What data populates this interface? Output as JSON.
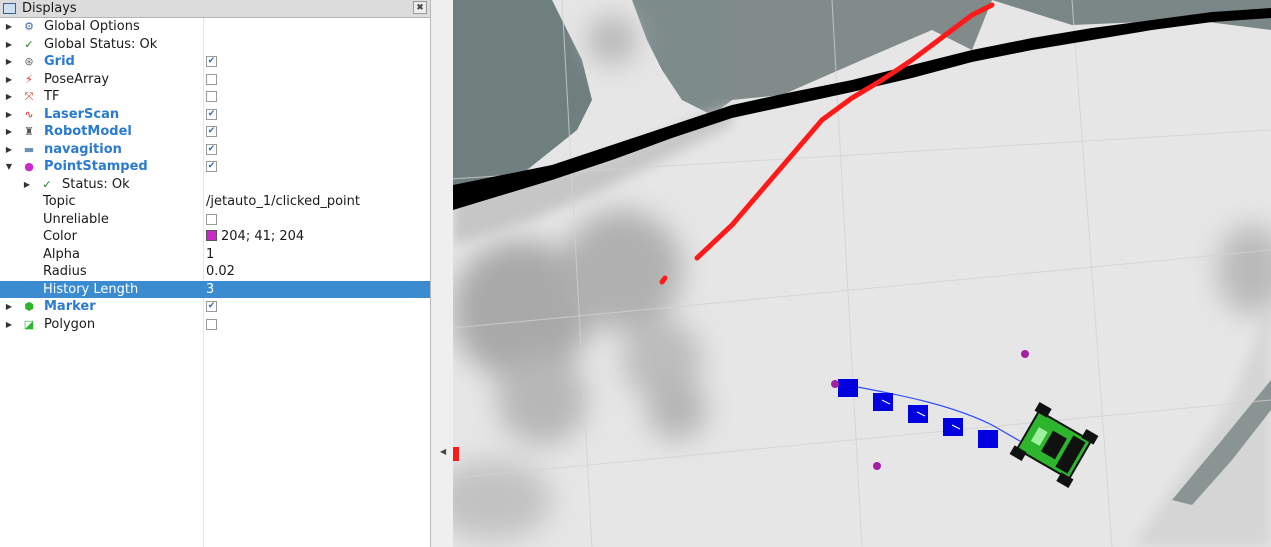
{
  "panel": {
    "title": "Displays",
    "title_icon": "monitor-icon",
    "close_icon": "close-icon",
    "rows": [
      {
        "label": "Global Options",
        "icon": "gear-icon",
        "arrow": "right",
        "enabled": null,
        "value": "",
        "level": 0,
        "bold": false
      },
      {
        "label": "Global Status: Ok",
        "icon": "check-icon",
        "arrow": "right",
        "enabled": null,
        "value": "",
        "level": 0,
        "bold": false
      },
      {
        "label": "Grid",
        "icon": "grid-icon",
        "arrow": "right",
        "enabled": true,
        "value": "",
        "level": 0,
        "bold": true
      },
      {
        "label": "PoseArray",
        "icon": "posearray-icon",
        "arrow": "right",
        "enabled": false,
        "value": "",
        "level": 0,
        "bold": false
      },
      {
        "label": "TF",
        "icon": "tf-icon",
        "arrow": "right",
        "enabled": false,
        "value": "",
        "level": 0,
        "bold": false
      },
      {
        "label": "LaserScan",
        "icon": "laserscan-icon",
        "arrow": "right",
        "enabled": true,
        "value": "",
        "level": 0,
        "bold": true
      },
      {
        "label": "RobotModel",
        "icon": "robot-icon",
        "arrow": "right",
        "enabled": true,
        "value": "",
        "level": 0,
        "bold": true
      },
      {
        "label": "navagition",
        "icon": "folder-icon",
        "arrow": "right",
        "enabled": true,
        "value": "",
        "level": 0,
        "bold": true
      },
      {
        "label": "PointStamped",
        "icon": "point-icon",
        "arrow": "down",
        "enabled": true,
        "value": "",
        "level": 0,
        "bold": true
      },
      {
        "label": "Status: Ok",
        "icon": "check-icon",
        "arrow": "right",
        "enabled": null,
        "value": "",
        "level": 1,
        "bold": false
      },
      {
        "label": "Topic",
        "icon": "",
        "arrow": "",
        "enabled": null,
        "value": "/jetauto_1/clicked_point",
        "level": 1,
        "bold": false
      },
      {
        "label": "Unreliable",
        "icon": "",
        "arrow": "",
        "enabled": false,
        "value": "",
        "level": 1,
        "bold": false
      },
      {
        "label": "Color",
        "icon": "",
        "arrow": "",
        "enabled": null,
        "value": "204; 41; 204",
        "swatch": "#cc29cc",
        "level": 1,
        "bold": false
      },
      {
        "label": "Alpha",
        "icon": "",
        "arrow": "",
        "enabled": null,
        "value": "1",
        "level": 1,
        "bold": false
      },
      {
        "label": "Radius",
        "icon": "",
        "arrow": "",
        "enabled": null,
        "value": "0.02",
        "level": 1,
        "bold": false
      },
      {
        "label": "History Length",
        "icon": "",
        "arrow": "",
        "enabled": null,
        "value": "3",
        "level": 1,
        "bold": false,
        "selected": true
      },
      {
        "label": "Marker",
        "icon": "marker-icon",
        "arrow": "right",
        "enabled": true,
        "value": "",
        "level": 0,
        "bold": true
      },
      {
        "label": "Polygon",
        "icon": "polygon-icon",
        "arrow": "right",
        "enabled": false,
        "value": "",
        "level": 0,
        "bold": false
      }
    ]
  },
  "viewport": {
    "accent_laser": "#ff1a1a",
    "accent_path": "#0000e0",
    "accent_point": "#cc29cc",
    "robot_color": "#2db52d"
  }
}
